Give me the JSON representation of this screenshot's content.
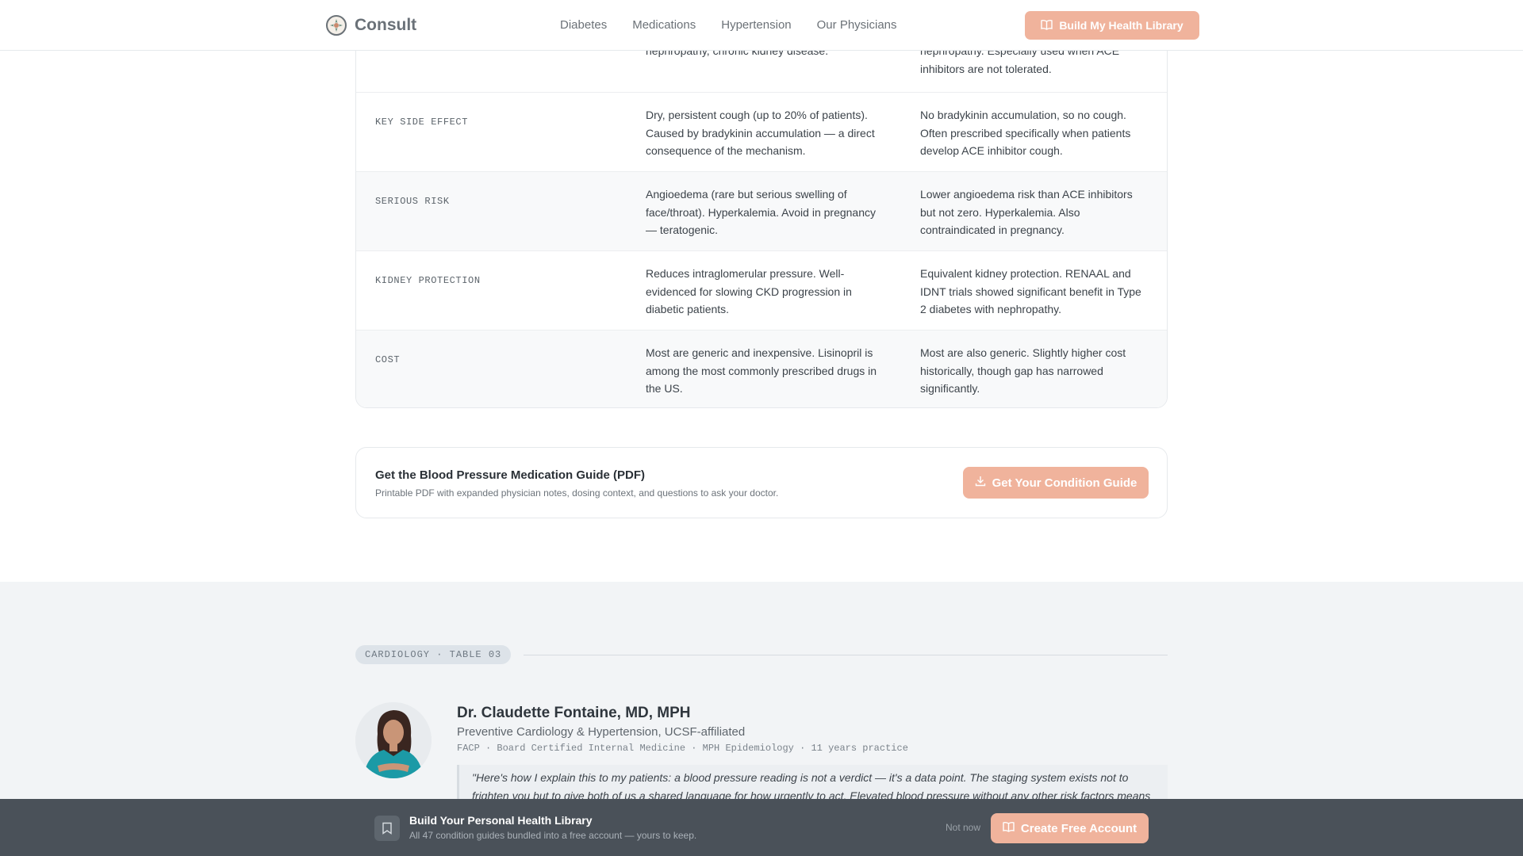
{
  "nav": {
    "brand": "Consult",
    "links": [
      "Diabetes",
      "Medications",
      "Hypertension",
      "Our Physicians"
    ],
    "cta": "Build My Health Library"
  },
  "table": {
    "partial_row": {
      "ace": "nephropathy, chronic kidney disease.",
      "arb_lines": [
        "nephropathy. Especially used when ACE",
        "inhibitors are not tolerated."
      ]
    },
    "rows": [
      {
        "label": "KEY SIDE EFFECT",
        "ace": [
          "Dry, persistent cough (up to 20% of patients).",
          "Caused by bradykinin accumulation — a direct",
          "consequence of the mechanism."
        ],
        "arb": [
          "No bradykinin accumulation, so no cough.",
          "Often prescribed specifically when patients",
          "develop ACE inhibitor cough."
        ]
      },
      {
        "label": "SERIOUS RISK",
        "ace": [
          "Angioedema (rare but serious swelling of",
          "face/throat). Hyperkalemia. Avoid in pregnancy",
          "— teratogenic."
        ],
        "arb": [
          "Lower angioedema risk than ACE inhibitors",
          "but not zero. Hyperkalemia. Also",
          "contraindicated in pregnancy."
        ]
      },
      {
        "label": "KIDNEY PROTECTION",
        "ace": [
          "Reduces intraglomerular pressure. Well-",
          "evidenced for slowing CKD progression in",
          "diabetic patients."
        ],
        "arb": [
          "Equivalent kidney protection. RENAAL and",
          "IDNT trials showed significant benefit in Type",
          "2 diabetes with nephropathy."
        ]
      },
      {
        "label": "COST",
        "ace": [
          "Most are generic and inexpensive. Lisinopril is",
          "among the most commonly prescribed drugs in",
          "the US."
        ],
        "arb": [
          "Most are also generic. Slightly higher cost",
          "historically, though gap has narrowed",
          "significantly."
        ]
      }
    ]
  },
  "download": {
    "title": "Get the Blood Pressure Medication Guide (PDF)",
    "subtitle": "Printable PDF with expanded physician notes, dosing context, and questions to ask your doctor.",
    "button": "Get Your Condition Guide"
  },
  "physician": {
    "tag": "CARDIOLOGY · TABLE 03",
    "name": "Dr. Claudette Fontaine, MD, MPH",
    "role": "Preventive Cardiology & Hypertension, UCSF-affiliated",
    "credentials": "FACP · Board Certified Internal Medicine · MPH Epidemiology · 11 years practice",
    "quote_lines": [
      "\"Here's how I explain this to my patients: a blood pressure reading is not a verdict — it's a data point. The staging system exists not to",
      "frighten you but to give both of us a shared language for how urgently to act. Elevated blood pressure without any other risk factors means"
    ]
  },
  "banner": {
    "title": "Build Your Personal Health Library",
    "subtitle": "All 47 condition guides bundled into a free account — yours to keep.",
    "dismiss": "Not now",
    "cta": "Create Free Account"
  },
  "colors": {
    "accent": "#f0b39c",
    "banner_bg": "#4a5159",
    "section_bg": "#f2f4f6"
  }
}
